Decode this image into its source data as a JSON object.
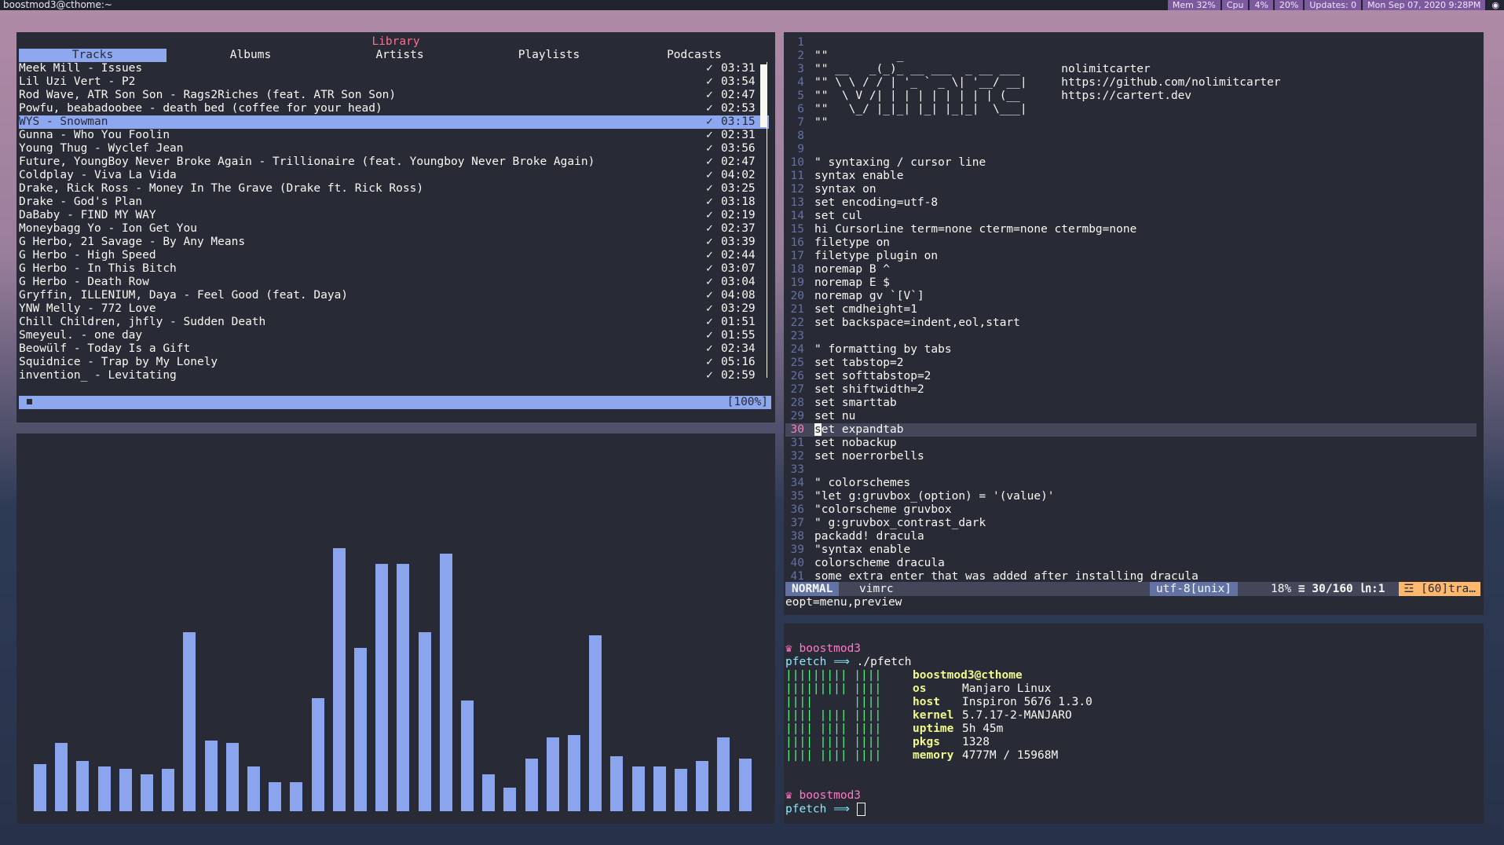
{
  "topbar": {
    "user_host": "boostmod3@cthome:~",
    "mem": "Mem 32%",
    "cpu": "Cpu",
    "cpu_pct1": "4%",
    "cpu_pct2": "20%",
    "updates": "Updates: 0",
    "datetime": "Mon Sep 07, 2020  9:28PM"
  },
  "cmus": {
    "title": "Library",
    "tabs": [
      "Tracks",
      "Albums",
      "Artists",
      "Playlists",
      "Podcasts"
    ],
    "active_tab": "Tracks",
    "tracks": [
      {
        "name": "Meek Mill - Issues",
        "time": "03:31"
      },
      {
        "name": "Lil Uzi Vert - P2",
        "time": "03:54"
      },
      {
        "name": "Rod Wave, ATR Son Son - Rags2Riches (feat. ATR Son Son)",
        "time": "02:47"
      },
      {
        "name": "Powfu, beabadoobee - death bed (coffee for your head)",
        "time": "02:53"
      },
      {
        "name": "WYS - Snowman",
        "time": "03:15"
      },
      {
        "name": "Gunna - Who You Foolin",
        "time": "02:31"
      },
      {
        "name": "Young Thug - Wyclef Jean",
        "time": "03:56"
      },
      {
        "name": "Future, YoungBoy Never Broke Again - Trillionaire (feat. Youngboy Never Broke Again)",
        "time": "02:47"
      },
      {
        "name": "Coldplay - Viva La Vida",
        "time": "04:02"
      },
      {
        "name": "Drake, Rick Ross - Money In The Grave (Drake ft. Rick Ross)",
        "time": "03:25"
      },
      {
        "name": "Drake - God's Plan",
        "time": "03:18"
      },
      {
        "name": "DaBaby - FIND MY WAY",
        "time": "02:19"
      },
      {
        "name": "Moneybagg Yo - Ion Get You",
        "time": "02:37"
      },
      {
        "name": "G Herbo, 21 Savage - By Any Means",
        "time": "03:39"
      },
      {
        "name": "G Herbo - High Speed",
        "time": "02:44"
      },
      {
        "name": "G Herbo - In This Bitch",
        "time": "03:07"
      },
      {
        "name": "G Herbo - Death Row",
        "time": "03:04"
      },
      {
        "name": "Gryffin, ILLENIUM, Daya - Feel Good (feat. Daya)",
        "time": "04:08"
      },
      {
        "name": "YNW Melly - 772 Love",
        "time": "03:29"
      },
      {
        "name": "Chill Children, jhfly - Sudden Death",
        "time": "01:51"
      },
      {
        "name": "Smeyeul. - one day",
        "time": "01:55"
      },
      {
        "name": "Beowülf - Today Is a Gift",
        "time": "02:34"
      },
      {
        "name": "Squidnice - Trap by My Lonely",
        "time": "05:16"
      },
      {
        "name": "invention_ - Levitating",
        "time": "02:59"
      }
    ],
    "selected_index": 4,
    "check": "✓",
    "status_pct": "[100%]"
  },
  "visualizer": {
    "levels": [
      0.18,
      0.26,
      0.19,
      0.17,
      0.16,
      0.14,
      0.16,
      0.68,
      0.27,
      0.26,
      0.17,
      0.11,
      0.11,
      0.43,
      1.0,
      0.62,
      0.94,
      0.94,
      0.68,
      0.98,
      0.42,
      0.14,
      0.09,
      0.2,
      0.28,
      0.29,
      0.67,
      0.21,
      0.17,
      0.17,
      0.16,
      0.19,
      0.28,
      0.2
    ]
  },
  "vim": {
    "ascii": [
      "\"\"          _",
      "\"\" __   _(_)_ __ ___  _ __ ___      nolimitcarter",
      "\"\" \\ \\ / / | '_ ` _ \\| '__/ __|     https://github.com/nolimitcarter",
      "\"\"  \\ V /| | | | | | | | | (__      https://cartert.dev",
      "\"\"   \\_/ |_|_| |_| |_|_|  \\___|",
      "\"\""
    ],
    "lines": [
      {
        "n": "1",
        "code": ""
      },
      {
        "n": "2",
        "code": ""
      },
      {
        "n": "3",
        "code": ""
      },
      {
        "n": "4",
        "code": ""
      },
      {
        "n": "5",
        "code": ""
      },
      {
        "n": "6",
        "code": ""
      },
      {
        "n": "7",
        "code": ""
      },
      {
        "n": "8",
        "code": ""
      },
      {
        "n": "9",
        "code": ""
      },
      {
        "n": "10",
        "code": "\" syntaxing / cursor line"
      },
      {
        "n": "11",
        "code": "syntax enable"
      },
      {
        "n": "12",
        "code": "syntax on"
      },
      {
        "n": "13",
        "code": "set encoding=utf-8"
      },
      {
        "n": "14",
        "code": "set cul"
      },
      {
        "n": "15",
        "code": "hi CursorLine term=none cterm=none ctermbg=none"
      },
      {
        "n": "16",
        "code": "filetype on"
      },
      {
        "n": "17",
        "code": "filetype plugin on"
      },
      {
        "n": "18",
        "code": "noremap B ^"
      },
      {
        "n": "19",
        "code": "noremap E $"
      },
      {
        "n": "20",
        "code": "noremap gv `[V`]"
      },
      {
        "n": "21",
        "code": "set cmdheight=1"
      },
      {
        "n": "22",
        "code": "set backspace=indent,eol,start"
      },
      {
        "n": "23",
        "code": ""
      },
      {
        "n": "24",
        "code": "\" formatting by tabs"
      },
      {
        "n": "25",
        "code": "set tabstop=2"
      },
      {
        "n": "26",
        "code": "set softtabstop=2"
      },
      {
        "n": "27",
        "code": "set shiftwidth=2"
      },
      {
        "n": "28",
        "code": "set smarttab"
      },
      {
        "n": "29",
        "code": "set nu"
      },
      {
        "n": "30",
        "code": "set expandtab"
      },
      {
        "n": "31",
        "code": "set nobackup"
      },
      {
        "n": "32",
        "code": "set noerrorbells"
      },
      {
        "n": "33",
        "code": ""
      },
      {
        "n": "34",
        "code": "\" colorschemes"
      },
      {
        "n": "35",
        "code": "\"let g:gruvbox_(option) = '(value)'"
      },
      {
        "n": "36",
        "code": "\"colorscheme gruvbox"
      },
      {
        "n": "37",
        "code": "\" g:gruvbox_contrast_dark"
      },
      {
        "n": "38",
        "code": "packadd! dracula"
      },
      {
        "n": "39",
        "code": "\"syntax enable"
      },
      {
        "n": "40",
        "code": "colorscheme dracula"
      },
      {
        "n": "41",
        "code": "some extra enter that was added after installing dracula"
      }
    ],
    "cursor_line": 30,
    "status": {
      "mode": "NORMAL",
      "file": "vimrc",
      "encoding": "utf-8[unix]",
      "percent": "18%",
      "position": "≡ 30/160 ㏑:1",
      "warning": "☲ [60]tra…"
    },
    "cmdline": "eopt=menu,preview"
  },
  "terminal": {
    "user": "boostmod3",
    "prompt_dir": "pfetch ⟹ ",
    "command": "./pfetch",
    "pf_header": "boostmod3@cthome",
    "pf_logo": [
      "||||||||| ||||",
      "||||||||| ||||",
      "||||      ||||",
      "|||| |||| ||||",
      "|||| |||| ||||",
      "|||| |||| ||||",
      "|||| |||| ||||"
    ],
    "pf_info": [
      {
        "key": "os",
        "val": "Manjaro Linux"
      },
      {
        "key": "host",
        "val": "Inspiron 5676 1.3.0"
      },
      {
        "key": "kernel",
        "val": "5.7.17-2-MANJARO"
      },
      {
        "key": "uptime",
        "val": "5h 45m"
      },
      {
        "key": "pkgs",
        "val": "1328"
      },
      {
        "key": "memory",
        "val": "4777M / 15968M"
      }
    ]
  }
}
